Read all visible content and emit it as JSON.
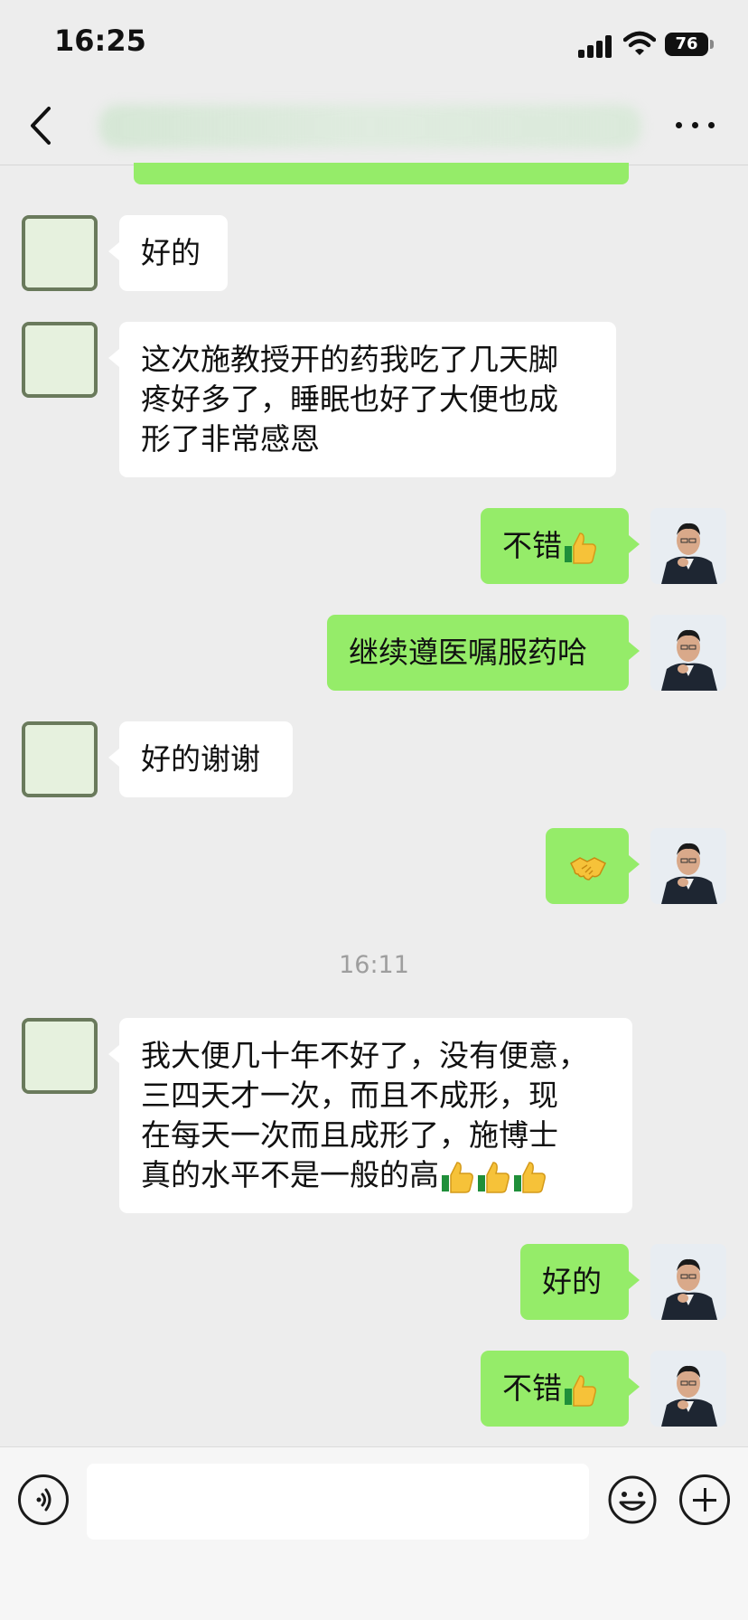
{
  "status_bar": {
    "time": "16:25",
    "battery": "76"
  },
  "chat": {
    "timestamp": "16:11",
    "messages": [
      {
        "side": "in",
        "text": "好的"
      },
      {
        "side": "in",
        "lines": [
          "这次施教授开的药我吃了几天脚",
          "疼好多了，睡眠也好了大便也成",
          "形了非常感恩"
        ]
      },
      {
        "side": "out",
        "text": "不错",
        "emoji": "thumbs-up"
      },
      {
        "side": "out",
        "text": "继续遵医嘱服药哈"
      },
      {
        "side": "in",
        "text": "好的谢谢"
      },
      {
        "side": "out",
        "text": "",
        "emoji": "handshake"
      },
      {
        "side": "in",
        "lines": [
          "我大便几十年不好了，没有便意，",
          "三四天才一次，而且不成形，现",
          "在每天一次而且成形了，施博士",
          "真的水平不是一般的高"
        ],
        "emoji": "thumbs-up x3"
      },
      {
        "side": "out",
        "text": "好的"
      },
      {
        "side": "out",
        "text": "不错",
        "emoji": "thumbs-up"
      }
    ]
  },
  "input_bar": {
    "value": ""
  },
  "colors": {
    "background": "#ededed",
    "bubble_out": "#95ec69",
    "bubble_in": "#ffffff"
  }
}
